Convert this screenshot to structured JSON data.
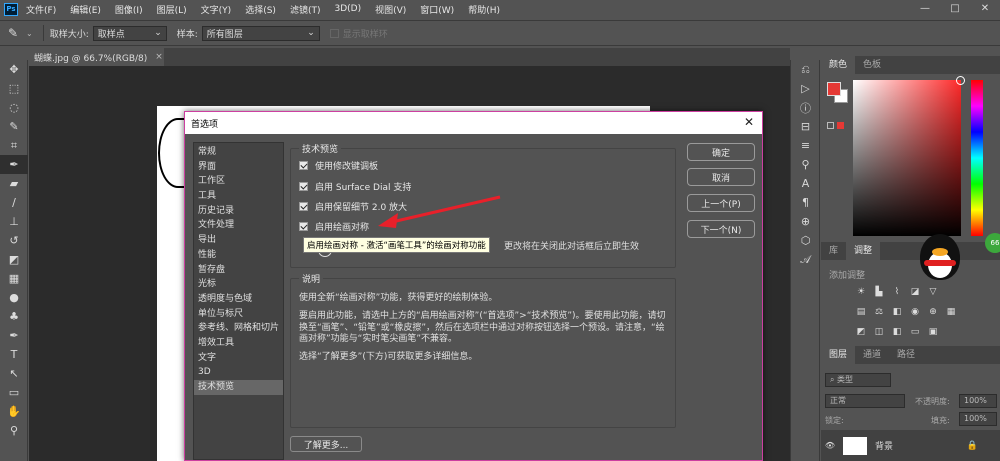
{
  "app": {
    "logo": "Ps",
    "menu": [
      "文件(F)",
      "编辑(E)",
      "图像(I)",
      "图层(L)",
      "文字(Y)",
      "选择(S)",
      "滤镜(T)",
      "3D(D)",
      "视图(V)",
      "窗口(W)",
      "帮助(H)"
    ],
    "window_controls": [
      "—",
      "□",
      "✕"
    ]
  },
  "options_bar": {
    "tool_icon": "eyedropper-icon",
    "sample_size_label": "取样大小:",
    "sample_size_value": "取样点",
    "sample_label": "样本:",
    "sample_value": "所有图层",
    "show_ring_label": "显示取样环"
  },
  "document": {
    "tab_title": "蝴蝶.jpg @ 66.7%(RGB/8)",
    "tab_close": "×"
  },
  "panels": {
    "color_tabs": [
      "颜色",
      "色板"
    ],
    "adjust_tabs": [
      "库",
      "调整"
    ],
    "adjust_add_label": "添加调整",
    "layers_tabs": [
      "图层",
      "通道",
      "路径"
    ],
    "layers_filter": "类型",
    "blend_mode": "正常",
    "opacity_label": "不透明度:",
    "opacity_value": "100%",
    "lock_label": "锁定:",
    "fill_label": "填充:",
    "fill_value": "100%",
    "layer_name": "背景",
    "badge_text": "66"
  },
  "dialog": {
    "title": "首选项",
    "close": "✕",
    "categories": [
      "常规",
      "界面",
      "工作区",
      "工具",
      "历史记录",
      "文件处理",
      "导出",
      "性能",
      "暂存盘",
      "光标",
      "透明度与色域",
      "单位与标尺",
      "参考线、网格和切片",
      "增效工具",
      "文字",
      "3D",
      "技术预览"
    ],
    "selected_category": "技术预览",
    "tech_preview_title": "技术预览",
    "options": [
      "使用修改键调板",
      "启用 Surface Dial 支持",
      "启用保留细节 2.0 放大",
      "启用绘画对称"
    ],
    "tooltip": "启用绘画对称 - 激活“画笔工具”的绘画对称功能",
    "note": "更改将在关闭此对话框后立即生效",
    "description_title": "说明",
    "description": [
      "使用全新“绘画对称”功能，获得更好的绘制体验。",
      "要启用此功能，请选中上方的“启用绘画对称”(“首选项”>“技术预览”)。要使用此功能，请切换至“画笔”、“铅笔”或“橡皮擦”，然后在选项栏中通过对称按钮选择一个预设。请注意，“绘画对称”功能与“实时笔尖画笔”不兼容。",
      "选择“了解更多”(下方)可获取更多详细信息。"
    ],
    "learn_more": "了解更多...",
    "buttons": [
      "确定",
      "取消",
      "上一个(P)",
      "下一个(N)"
    ]
  },
  "colors": {
    "foreground": "#e53935",
    "background": "#ffffff",
    "annotation_arrow": "#e8202a",
    "dialog_border": "#cc3fa0"
  }
}
